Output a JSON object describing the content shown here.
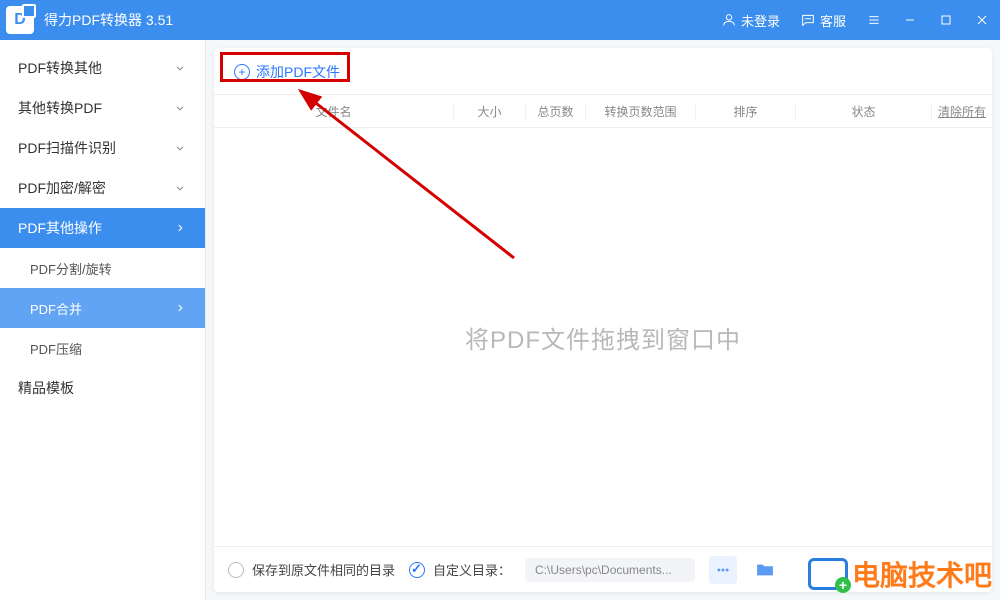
{
  "app": {
    "title": "得力PDF转换器 3.51",
    "logo_letter": "D"
  },
  "titlebar": {
    "login": "未登录",
    "support": "客服"
  },
  "sidebar": {
    "items": [
      {
        "label": "PDF转换其他"
      },
      {
        "label": "其他转换PDF"
      },
      {
        "label": "PDF扫描件识别"
      },
      {
        "label": "PDF加密/解密"
      },
      {
        "label": "PDF其他操作"
      }
    ],
    "subitems": [
      {
        "label": "PDF分割/旋转"
      },
      {
        "label": "PDF合并"
      },
      {
        "label": "PDF压缩"
      }
    ],
    "templates": "精品模板"
  },
  "toolbar": {
    "add_label": "添加PDF文件"
  },
  "table": {
    "headers": [
      "文件名",
      "大小",
      "总页数",
      "转换页数范围",
      "排序",
      "状态",
      "清除所有"
    ]
  },
  "dropzone": {
    "text": "将PDF文件拖拽到窗口中"
  },
  "footer": {
    "same_dir": "保存到原文件相同的目录",
    "custom_dir": "自定义目录：",
    "path": "C:\\Users\\pc\\Documents..."
  },
  "watermark": {
    "text": "电脑技术吧"
  }
}
